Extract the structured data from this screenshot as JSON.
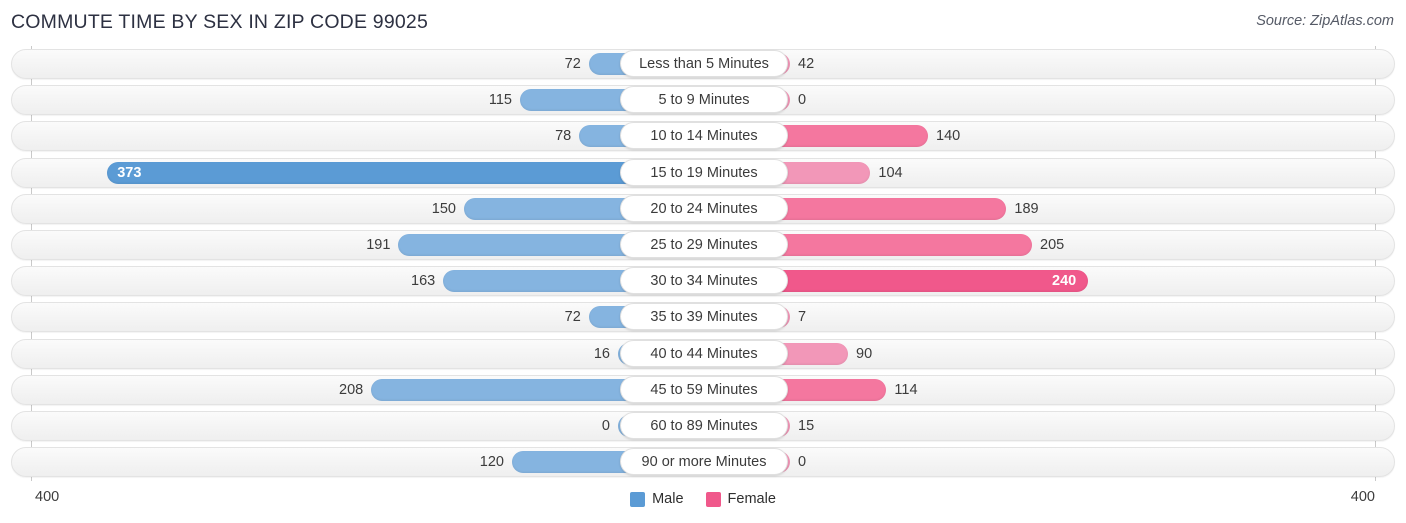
{
  "header": {
    "title": "COMMUTE TIME BY SEX IN ZIP CODE 99025",
    "source": "Source: ZipAtlas.com"
  },
  "axis": {
    "left_tick": "400",
    "right_tick": "400"
  },
  "legend": {
    "items": [
      {
        "label": "Male",
        "color": "#5b9bd5"
      },
      {
        "label": "Female",
        "color": "#f0588b"
      }
    ]
  },
  "chart_data": {
    "type": "bar",
    "orientation": "horizontal-diverging",
    "title": "COMMUTE TIME BY SEX IN ZIP CODE 99025",
    "subtitle": "Source: ZipAtlas.com",
    "xlabel": "",
    "ylabel": "",
    "xlim": [
      -400,
      400
    ],
    "axis_max": 400,
    "grid": false,
    "legend_position": "bottom-center",
    "categories": [
      "Less than 5 Minutes",
      "5 to 9 Minutes",
      "10 to 14 Minutes",
      "15 to 19 Minutes",
      "20 to 24 Minutes",
      "25 to 29 Minutes",
      "30 to 34 Minutes",
      "35 to 39 Minutes",
      "40 to 44 Minutes",
      "45 to 59 Minutes",
      "60 to 89 Minutes",
      "90 or more Minutes"
    ],
    "series": [
      {
        "name": "Male",
        "color": "#85b4e0",
        "values": [
          72,
          115,
          78,
          373,
          150,
          191,
          163,
          72,
          16,
          208,
          0,
          120
        ]
      },
      {
        "name": "Female",
        "color": "#f297b8",
        "values": [
          42,
          0,
          140,
          104,
          189,
          205,
          240,
          7,
          90,
          114,
          15,
          0
        ]
      }
    ],
    "rows": [
      {
        "category": "Less than 5 Minutes",
        "male": 72,
        "male_text": "72",
        "female": 42,
        "female_text": "42"
      },
      {
        "category": "5 to 9 Minutes",
        "male": 115,
        "male_text": "115",
        "female": 0,
        "female_text": "0"
      },
      {
        "category": "10 to 14 Minutes",
        "male": 78,
        "male_text": "78",
        "female": 140,
        "female_text": "140"
      },
      {
        "category": "15 to 19 Minutes",
        "male": 373,
        "male_text": "373",
        "female": 104,
        "female_text": "104"
      },
      {
        "category": "20 to 24 Minutes",
        "male": 150,
        "male_text": "150",
        "female": 189,
        "female_text": "189"
      },
      {
        "category": "25 to 29 Minutes",
        "male": 191,
        "male_text": "191",
        "female": 205,
        "female_text": "205"
      },
      {
        "category": "30 to 34 Minutes",
        "male": 163,
        "male_text": "163",
        "female": 240,
        "female_text": "240"
      },
      {
        "category": "35 to 39 Minutes",
        "male": 72,
        "male_text": "72",
        "female": 7,
        "female_text": "7"
      },
      {
        "category": "40 to 44 Minutes",
        "male": 16,
        "male_text": "16",
        "female": 90,
        "female_text": "90"
      },
      {
        "category": "45 to 59 Minutes",
        "male": 208,
        "male_text": "208",
        "female": 114,
        "female_text": "114"
      },
      {
        "category": "60 to 89 Minutes",
        "male": 0,
        "male_text": "0",
        "female": 15,
        "female_text": "15"
      },
      {
        "category": "90 or more Minutes",
        "male": 120,
        "male_text": "120",
        "female": 0,
        "female_text": "0"
      }
    ]
  }
}
